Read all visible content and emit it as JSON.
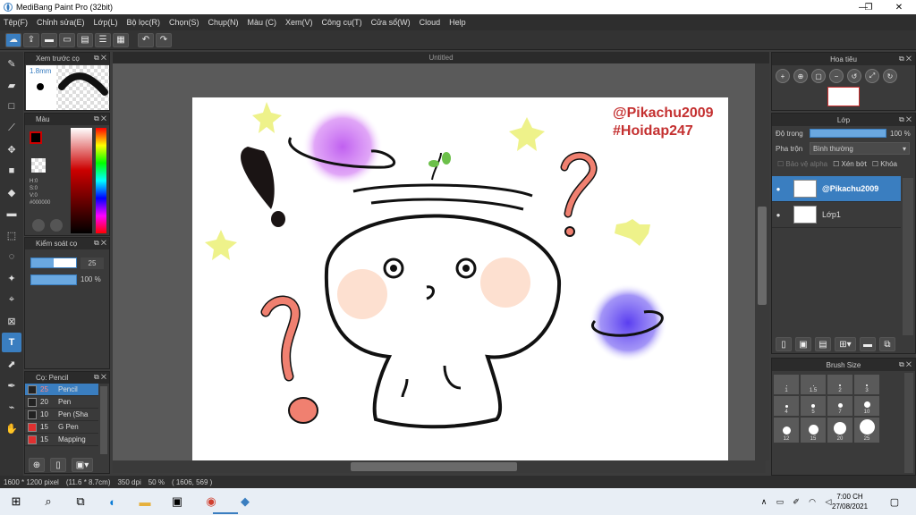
{
  "window": {
    "title": "MediBang Paint Pro (32bit)",
    "min": "—",
    "max": "❐",
    "close": "✕"
  },
  "menu": [
    "Tệp(F)",
    "Chỉnh sửa(E)",
    "Lớp(L)",
    "Bộ lọc(R)",
    "Chọn(S)",
    "Chụp(N)",
    "Màu (C)",
    "Xem(V)",
    "Công cụ(T)",
    "Cửa sổ(W)",
    "Cloud",
    "Help"
  ],
  "brush_preview": {
    "title": "Xem trước cọ",
    "size": "1.8mm"
  },
  "color_panel": {
    "title": "Màu",
    "h": "H:0",
    "s": "S:0",
    "v": "V:0",
    "hex": "#000000"
  },
  "brush_control": {
    "title": "Kiểm soát cọ",
    "size": "25",
    "opacity": "100 %",
    "opacity_fill": 1.0
  },
  "brush_list": {
    "title": "Cọ: Pencil",
    "items": [
      {
        "size": "25",
        "name": "Pencil",
        "color": "#222222",
        "selected": true
      },
      {
        "size": "20",
        "name": "Pen",
        "color": "#222222",
        "selected": false
      },
      {
        "size": "10",
        "name": "Pen (Sha",
        "color": "#222222",
        "selected": false
      },
      {
        "size": "15",
        "name": "G Pen",
        "color": "#e03030",
        "selected": false
      },
      {
        "size": "15",
        "name": "Mapping",
        "color": "#e03030",
        "selected": false
      }
    ]
  },
  "canvas": {
    "tab": "Untitled",
    "watermark1": "@Pikachu2009",
    "watermark2": "#Hoidap247"
  },
  "navigator": {
    "title": "Hoa tiêu"
  },
  "layer_panel": {
    "title": "Lớp",
    "opacity_label": "Độ trong",
    "opacity_value": "100 %",
    "blend_label": "Pha trộn",
    "blend_value": "Bình thường",
    "protect_alpha": "Bảo vệ alpha",
    "clipping": "Xén bớt",
    "lock": "Khóa",
    "layers": [
      {
        "name": "@Pikachu2009",
        "selected": true
      },
      {
        "name": "Lớp1",
        "selected": false
      }
    ]
  },
  "brush_size_panel": {
    "title": "Brush Size",
    "sizes": [
      "1",
      "1.5",
      "2",
      "3",
      "4",
      "5",
      "7",
      "10",
      "12",
      "15",
      "20",
      "25"
    ]
  },
  "status": {
    "dims": "1600 * 1200 pixel",
    "cm": "(11.6 * 8.7cm)",
    "dpi": "350 dpi",
    "zoom": "50 %",
    "coords": "( 1606, 569 )"
  },
  "taskbar": {
    "time": "7:00 CH",
    "date": "27/08/2021"
  },
  "colors": {
    "accent": "#3a7ec0",
    "panel": "#3a3a3a",
    "canvas_bg": "#5a5a5a"
  }
}
